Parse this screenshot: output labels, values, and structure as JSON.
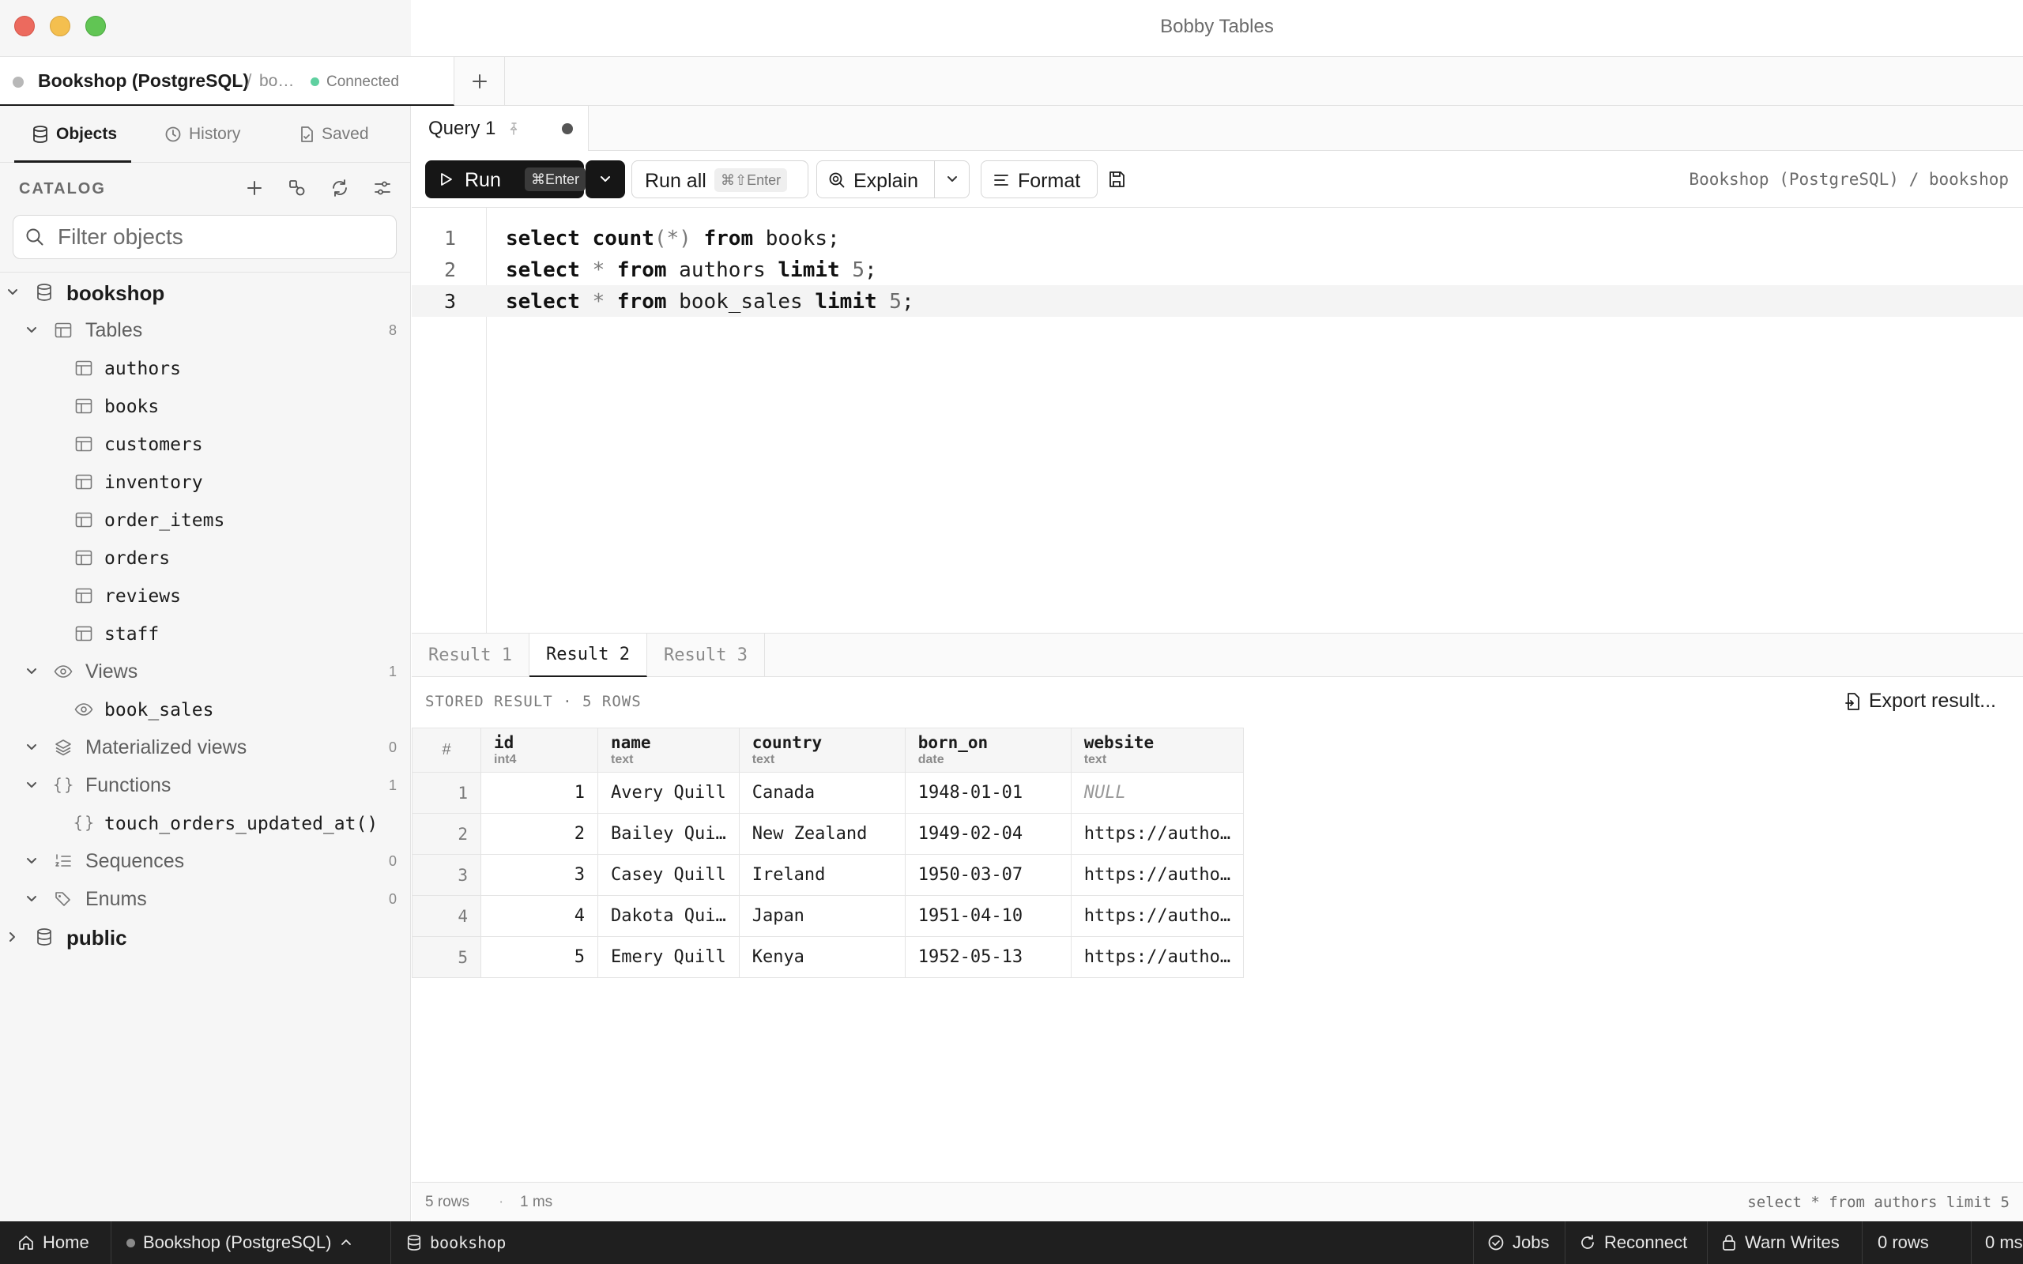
{
  "window": {
    "title": "Bobby Tables"
  },
  "connection_tab": {
    "name": "Bookshop (PostgreSQL)",
    "separator": "/",
    "db_truncated": "bo…",
    "status": "Connected"
  },
  "sidebar": {
    "tabs": [
      {
        "label": "Objects",
        "icon": "database-icon",
        "active": true
      },
      {
        "label": "History",
        "icon": "clock-icon",
        "active": false
      },
      {
        "label": "Saved",
        "icon": "saved-file-icon",
        "active": false
      }
    ],
    "catalog_label": "CATALOG",
    "filter_placeholder": "Filter objects",
    "tree": {
      "database": "bookshop",
      "groups": {
        "tables": {
          "label": "Tables",
          "count": "8",
          "items": [
            "authors",
            "books",
            "customers",
            "inventory",
            "order_items",
            "orders",
            "reviews",
            "staff"
          ]
        },
        "views": {
          "label": "Views",
          "count": "1",
          "items": [
            "book_sales"
          ]
        },
        "materialized": {
          "label": "Materialized views",
          "count": "0"
        },
        "functions": {
          "label": "Functions",
          "count": "1",
          "items": [
            "touch_orders_updated_at()"
          ]
        },
        "sequences": {
          "label": "Sequences",
          "count": "0"
        },
        "enums": {
          "label": "Enums",
          "count": "0"
        }
      },
      "schema2": "public"
    }
  },
  "query_tab": {
    "name": "Query 1"
  },
  "toolbar": {
    "run_label": "Run",
    "run_shortcut": "⌘Enter",
    "run_all_label": "Run all",
    "run_all_shortcut": "⌘⇧Enter",
    "explain_label": "Explain",
    "format_label": "Format",
    "path": "Bookshop (PostgreSQL) / bookshop"
  },
  "editor": {
    "line_numbers": [
      "1",
      "2",
      "3"
    ],
    "active_line": 3
  },
  "results": {
    "tabs": [
      "Result 1",
      "Result 2",
      "Result 3"
    ],
    "active_tab": "Result 2",
    "meta": "STORED RESULT · 5 ROWS",
    "export_label": "Export result...",
    "columns": [
      {
        "name": "#",
        "type": ""
      },
      {
        "name": "id",
        "type": "int4"
      },
      {
        "name": "name",
        "type": "text"
      },
      {
        "name": "country",
        "type": "text"
      },
      {
        "name": "born_on",
        "type": "date"
      },
      {
        "name": "website",
        "type": "text"
      }
    ],
    "rows": [
      [
        "1",
        "1",
        "Avery Quill",
        "Canada",
        "1948-01-01",
        "NULL"
      ],
      [
        "2",
        "2",
        "Bailey Qui…",
        "New Zealand",
        "1949-02-04",
        "https://autho…"
      ],
      [
        "3",
        "3",
        "Casey Quill",
        "Ireland",
        "1950-03-07",
        "https://autho…"
      ],
      [
        "4",
        "4",
        "Dakota Qui…",
        "Japan",
        "1951-04-10",
        "https://autho…"
      ],
      [
        "5",
        "5",
        "Emery Quill",
        "Kenya",
        "1952-05-13",
        "https://autho…"
      ]
    ],
    "footer_rows": "5 rows",
    "footer_sep": "·",
    "footer_time": "1 ms",
    "footer_sql": "select * from authors limit 5"
  },
  "statusbar": {
    "home": "Home",
    "connection": "Bookshop (PostgreSQL)",
    "database": "bookshop",
    "jobs": "Jobs",
    "reconnect": "Reconnect",
    "warn_writes": "Warn Writes",
    "rows": "0 rows",
    "time": "0 ms"
  },
  "colors": {
    "accent": "#1c1c1c",
    "connected": "#5fd0a0",
    "statusbar_bg": "#1f1f1f"
  }
}
